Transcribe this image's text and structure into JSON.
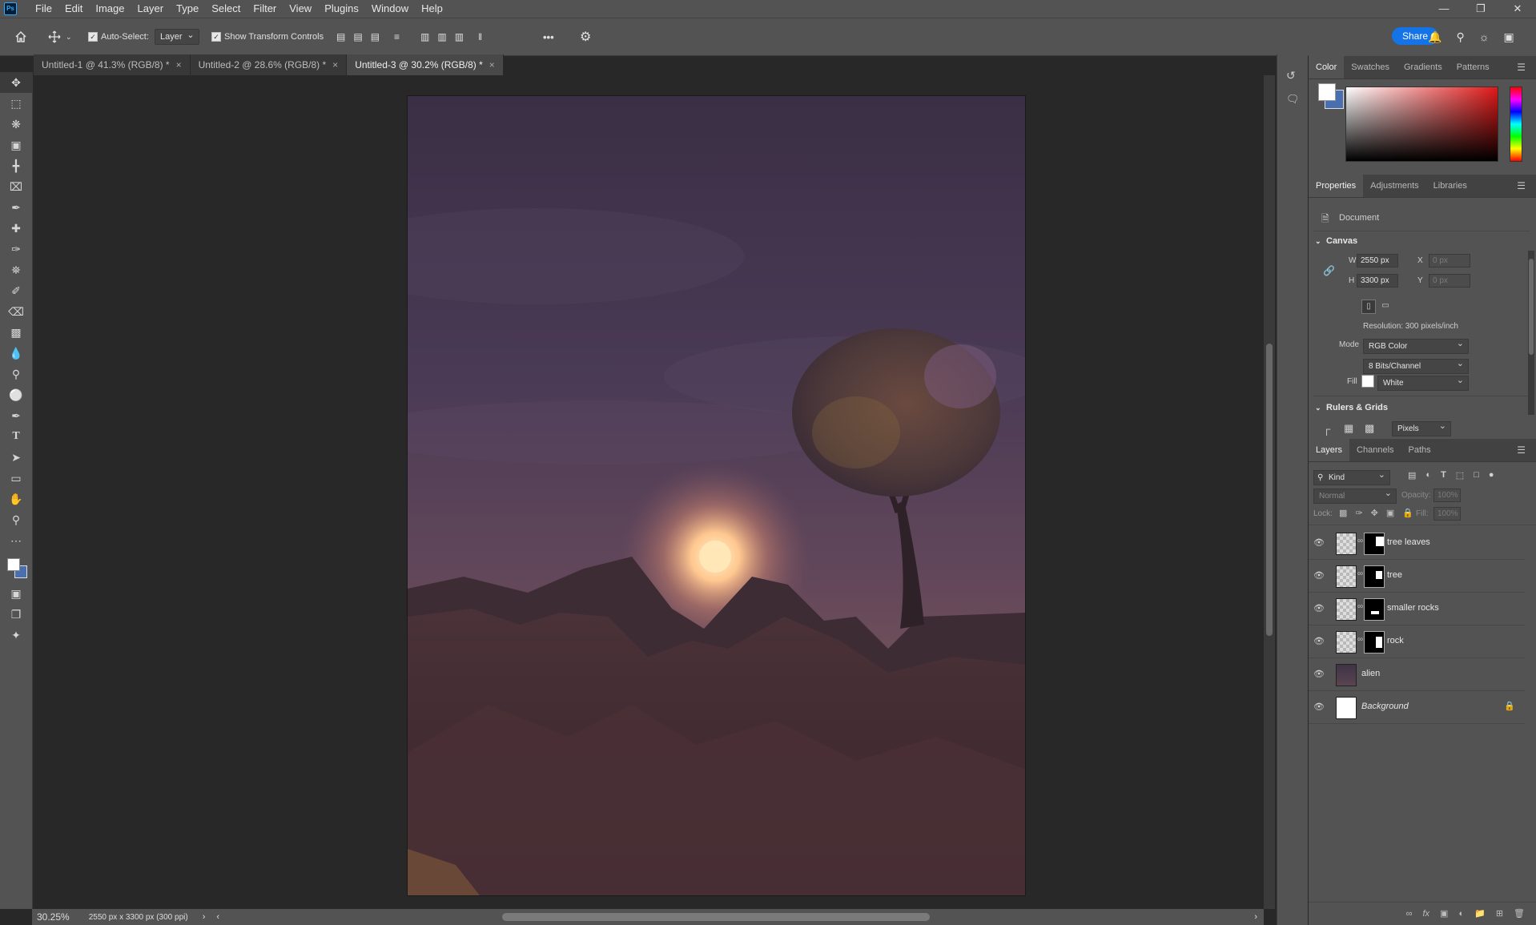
{
  "app": {
    "icon_text": "Ps"
  },
  "menu": [
    "File",
    "Edit",
    "Image",
    "Layer",
    "Type",
    "Select",
    "Filter",
    "View",
    "Plugins",
    "Window",
    "Help"
  ],
  "options_bar": {
    "auto_select_label": "Auto-Select:",
    "auto_select_checked": true,
    "auto_select_target": "Layer",
    "show_transform_label": "Show Transform Controls",
    "show_transform_checked": true,
    "more_label": "•••",
    "share_label": "Share"
  },
  "tabs": [
    {
      "label": "Untitled-1 @ 41.3% (RGB/8) *",
      "active": false
    },
    {
      "label": "Untitled-2 @ 28.6% (RGB/8) *",
      "active": false
    },
    {
      "label": "Untitled-3 @ 30.2% (RGB/8) *",
      "active": true
    }
  ],
  "status": {
    "zoom": "30.25%",
    "doc_info": "2550 px x 3300 px (300 ppi)"
  },
  "color_panel": {
    "tabs": [
      "Color",
      "Swatches",
      "Gradients",
      "Patterns"
    ],
    "active": "Color",
    "hue_color": "#e01818"
  },
  "properties": {
    "tabs": [
      "Properties",
      "Adjustments",
      "Libraries"
    ],
    "active": "Properties",
    "kind": "Document",
    "canvas_section": "Canvas",
    "width_label": "W",
    "width": "2550 px",
    "height_label": "H",
    "height": "3300 px",
    "x_label": "X",
    "x_placeholder": "0 px",
    "y_label": "Y",
    "y_placeholder": "0 px",
    "resolution": "Resolution: 300 pixels/inch",
    "mode_label": "Mode",
    "mode": "RGB Color",
    "bits": "8 Bits/Channel",
    "fill_label": "Fill",
    "fill": "White",
    "rulers_section": "Rulers & Grids",
    "units": "Pixels"
  },
  "layers_panel": {
    "tabs": [
      "Layers",
      "Channels",
      "Paths"
    ],
    "active": "Layers",
    "filter_kind": "Kind",
    "blend_mode": "Normal",
    "opacity_label": "Opacity:",
    "opacity": "100%",
    "lock_label": "Lock:",
    "fill_label": "Fill:",
    "fill": "100%",
    "layers": [
      {
        "name": "tree leaves",
        "visible": true,
        "has_mask": true,
        "italic": false,
        "locked": false
      },
      {
        "name": "tree",
        "visible": true,
        "has_mask": true,
        "italic": false,
        "locked": false
      },
      {
        "name": "smaller rocks",
        "visible": true,
        "has_mask": true,
        "italic": false,
        "locked": false
      },
      {
        "name": "rock",
        "visible": true,
        "has_mask": true,
        "italic": false,
        "locked": false
      },
      {
        "name": "alien",
        "visible": true,
        "has_mask": false,
        "italic": false,
        "locked": false
      },
      {
        "name": "Background",
        "visible": true,
        "has_mask": false,
        "italic": true,
        "locked": true
      }
    ]
  }
}
